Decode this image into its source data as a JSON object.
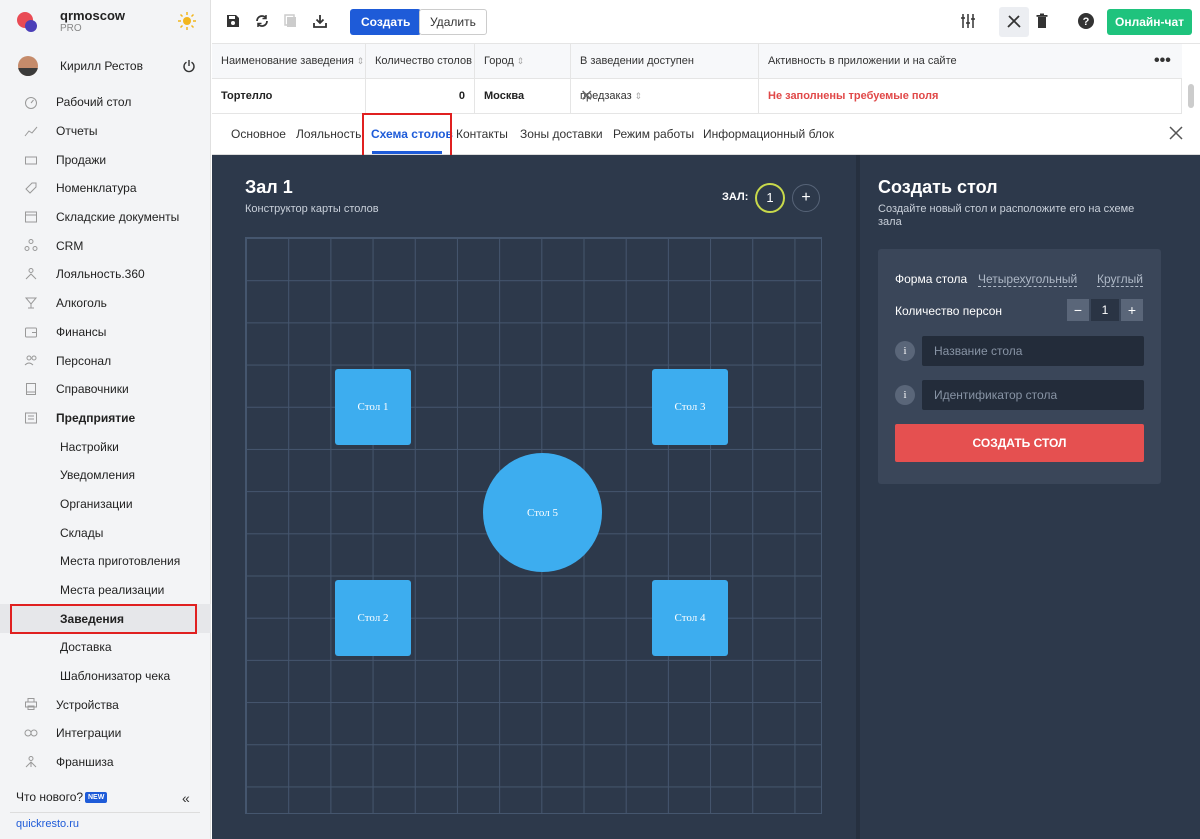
{
  "brand": {
    "name": "qrmoscow",
    "plan": "PRO",
    "logo_colors": [
      "#e94b55",
      "#4b3fb8"
    ]
  },
  "user": {
    "name": "Кирилл Рестов"
  },
  "sidebar": {
    "items": [
      {
        "label": "Рабочий стол",
        "icon": "dashboard-icon"
      },
      {
        "label": "Отчеты",
        "icon": "chart-icon"
      },
      {
        "label": "Продажи",
        "icon": "basket-icon"
      },
      {
        "label": "Номенклатура",
        "icon": "tag-icon"
      },
      {
        "label": "Складские документы",
        "icon": "archive-icon"
      },
      {
        "label": "CRM",
        "icon": "people-icon"
      },
      {
        "label": "Лояльность.360",
        "icon": "loyalty-icon"
      },
      {
        "label": "Алкоголь",
        "icon": "glass-icon"
      },
      {
        "label": "Финансы",
        "icon": "wallet-icon"
      },
      {
        "label": "Персонал",
        "icon": "staff-icon"
      },
      {
        "label": "Справочники",
        "icon": "book-icon"
      },
      {
        "label": "Предприятие",
        "icon": "enterprise-icon"
      }
    ],
    "subitems": [
      {
        "label": "Настройки"
      },
      {
        "label": "Уведомления"
      },
      {
        "label": "Организации"
      },
      {
        "label": "Склады"
      },
      {
        "label": "Места приготовления"
      },
      {
        "label": "Места реализации"
      },
      {
        "label": "Заведения"
      },
      {
        "label": "Доставка"
      },
      {
        "label": "Шаблонизатор чека"
      }
    ],
    "bottom_items": [
      {
        "label": "Устройства",
        "icon": "printer-icon"
      },
      {
        "label": "Интеграции",
        "icon": "link-icon"
      },
      {
        "label": "Франшиза",
        "icon": "franchise-icon"
      }
    ],
    "whats_new": "Что нового?",
    "new_badge": "NEW",
    "collapse": "«",
    "site_link": "quickresto.ru"
  },
  "toolbar": {
    "create_label": "Создать",
    "delete_label": "Удалить",
    "chat_label": "Онлайн-чат",
    "accent": "#1e5bd8",
    "chat_color": "#1fc37d"
  },
  "table": {
    "columns": [
      "Наименование заведения",
      "Количество столов",
      "Город",
      "В заведении доступен предзаказ",
      "Активность в приложении и на сайте"
    ],
    "row": {
      "name": "Тортелло",
      "tables": "0",
      "city": "Москва",
      "preorder": "✕",
      "activity": "Не заполнены требуемые поля"
    },
    "more": "•••"
  },
  "tabs": [
    {
      "label": "Основное"
    },
    {
      "label": "Лояльность"
    },
    {
      "label": "Схема столов"
    },
    {
      "label": "Контакты"
    },
    {
      "label": "Зоны доставки"
    },
    {
      "label": "Режим работы"
    },
    {
      "label": "Информационный блок"
    }
  ],
  "hall": {
    "title": "Зал 1",
    "subtitle": "Конструктор карты столов",
    "hall_label": "ЗАЛ:",
    "hall_number": "1",
    "add": "+",
    "tables": [
      {
        "label": "Стол 1",
        "shape": "square"
      },
      {
        "label": "Стол 3",
        "shape": "square"
      },
      {
        "label": "Стол 5",
        "shape": "round"
      },
      {
        "label": "Стол 2",
        "shape": "square"
      },
      {
        "label": "Стол 4",
        "shape": "square"
      }
    ]
  },
  "create_panel": {
    "title": "Создать стол",
    "subtitle": "Создайте новый стол и расположите его на схеме зала",
    "shape_label": "Форма стола",
    "shape_square": "Четырехугольный",
    "shape_round": "Круглый",
    "persons_label": "Количество персон",
    "persons_value": "1",
    "minus": "−",
    "plus": "+",
    "info": "i",
    "name_placeholder": "Название стола",
    "id_placeholder": "Идентификатор стола",
    "submit_label": "СОЗДАТЬ СТОЛ",
    "submit_color": "#e55050"
  }
}
